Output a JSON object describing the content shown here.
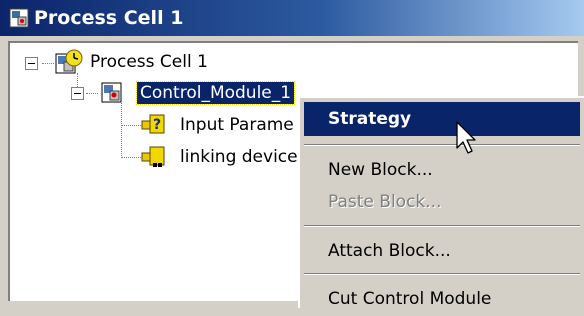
{
  "window": {
    "title": "Process Cell 1"
  },
  "tree": {
    "root": {
      "label": "Process Cell 1"
    },
    "module": {
      "label": "Control_Module_1"
    },
    "children": [
      {
        "label": "Input Parame"
      },
      {
        "label": "linking device"
      }
    ]
  },
  "context_menu": {
    "items": [
      {
        "label": "Strategy",
        "state": "default, highlighted"
      },
      {
        "label": "New Block..."
      },
      {
        "label": "Paste Block...",
        "state": "disabled"
      },
      {
        "label": "Attach Block..."
      },
      {
        "label": "Cut Control Module"
      }
    ]
  },
  "colors": {
    "selection": "#0a246a",
    "title_gradient_start": "#0b246a",
    "face": "#d4d0c8"
  }
}
